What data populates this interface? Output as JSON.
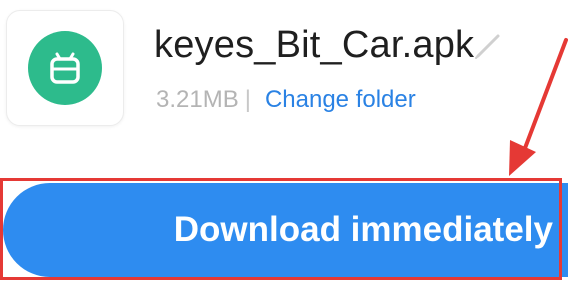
{
  "file": {
    "name": "keyes_Bit_Car.apk",
    "size": "3.21MB",
    "separator": "|",
    "change_folder_label": "Change folder"
  },
  "icons": {
    "app_icon": "android-icon",
    "edit": "pencil-icon"
  },
  "download": {
    "label": "Download immediately"
  },
  "colors": {
    "app_icon_bg": "#2dbb8c",
    "accent_blue": "#2a82e4",
    "button_blue": "#2e8cf0",
    "annotation_red": "#e53935"
  }
}
